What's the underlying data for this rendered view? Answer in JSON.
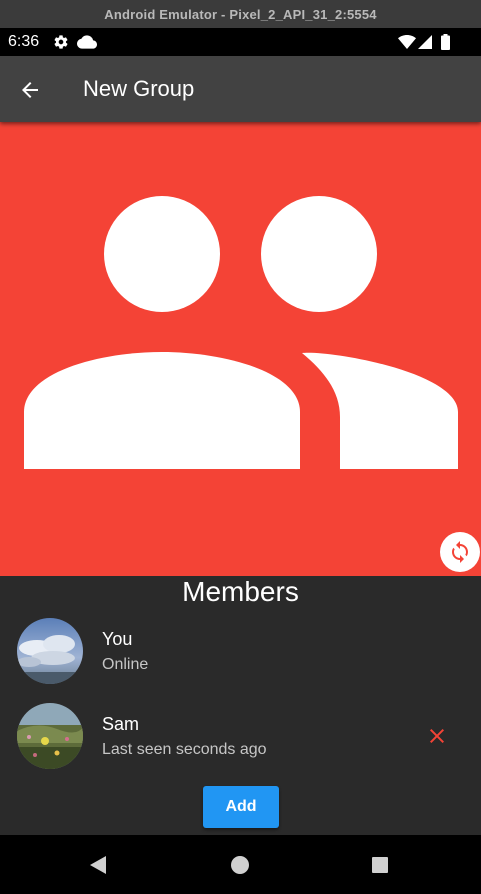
{
  "window": {
    "title": "Android Emulator - Pixel_2_API_31_2:5554"
  },
  "status_bar": {
    "time": "6:36",
    "icons": [
      "gear-icon",
      "cloud-icon",
      "wifi-icon",
      "signal-icon",
      "battery-icon"
    ]
  },
  "app_bar": {
    "title": "New Group",
    "back_icon": "arrow-back-icon"
  },
  "hero": {
    "background": "#f44336",
    "icon": "group-icon",
    "action_icon": "rotate-icon"
  },
  "members": {
    "title": "Members",
    "list": [
      {
        "name": "You",
        "status": "Online",
        "avatar": "sky-clouds-photo",
        "removable": false
      },
      {
        "name": "Sam",
        "status": "Last seen seconds ago",
        "avatar": "flower-field-photo",
        "removable": true,
        "remove_icon": "close-icon",
        "remove_color": "#f44336"
      }
    ]
  },
  "add_button": {
    "label": "Add",
    "color": "#2196f3"
  },
  "nav_bar": {
    "icons": [
      "back-triangle-icon",
      "home-circle-icon",
      "recents-square-icon"
    ]
  }
}
